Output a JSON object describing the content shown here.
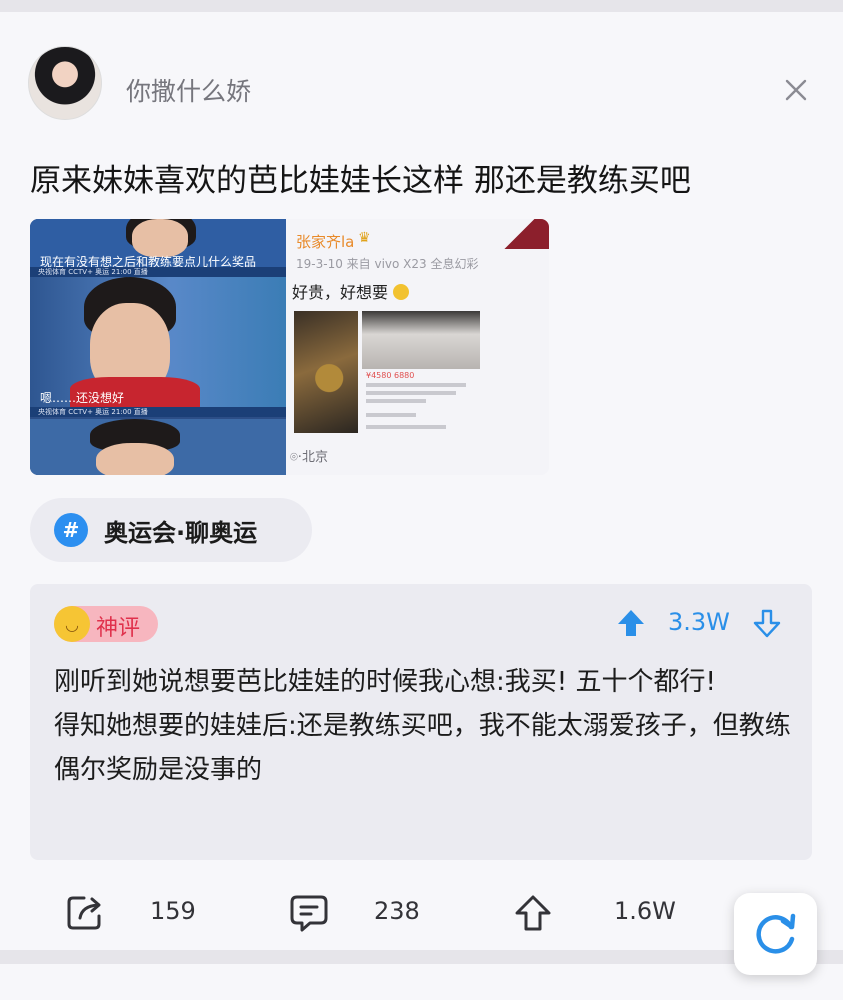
{
  "post": {
    "username": "你撒什么娇",
    "text": "原来妹妹喜欢的芭比娃娃长这样 那还是教练买吧",
    "image_left": {
      "caption_1": "现在有没有想之后和教练要点儿什么奖品",
      "caption_2": "嗯……还没想好",
      "ticker": "央视体育 CCTV+ 奥运 21:00 直播"
    },
    "image_right": {
      "name": "张家齐la",
      "meta": "19-3-10  来自 vivo X23 全息幻彩",
      "body": "好贵，好想要",
      "price": "¥4580 6880",
      "location": "北京"
    },
    "topic": "奥运会·聊奥运"
  },
  "comment": {
    "badge": "神评",
    "vote_count": "3.3W",
    "paragraph_1": "刚听到她说想要芭比娃娃的时候我心想:我买! 五十个都行!",
    "paragraph_2": "得知她想要的娃娃后:还是教练买吧，我不能太溺爱孩子，但教练偶尔奖励是没事的"
  },
  "actions": {
    "share_count": "159",
    "comment_count": "238",
    "like_count": "1.6W"
  },
  "icons": {
    "close": "close-icon",
    "hashtag": "hashtag-icon",
    "upvote": "upvote-arrow-icon",
    "downvote": "downvote-arrow-icon",
    "share": "share-icon",
    "comment": "comment-icon",
    "like": "like-icon",
    "refresh": "refresh-icon"
  },
  "colors": {
    "accent_blue": "#2a8fe8",
    "badge_red": "#e0314c",
    "badge_bg": "#f7b6bf",
    "badge_emoji": "#f6c534"
  }
}
